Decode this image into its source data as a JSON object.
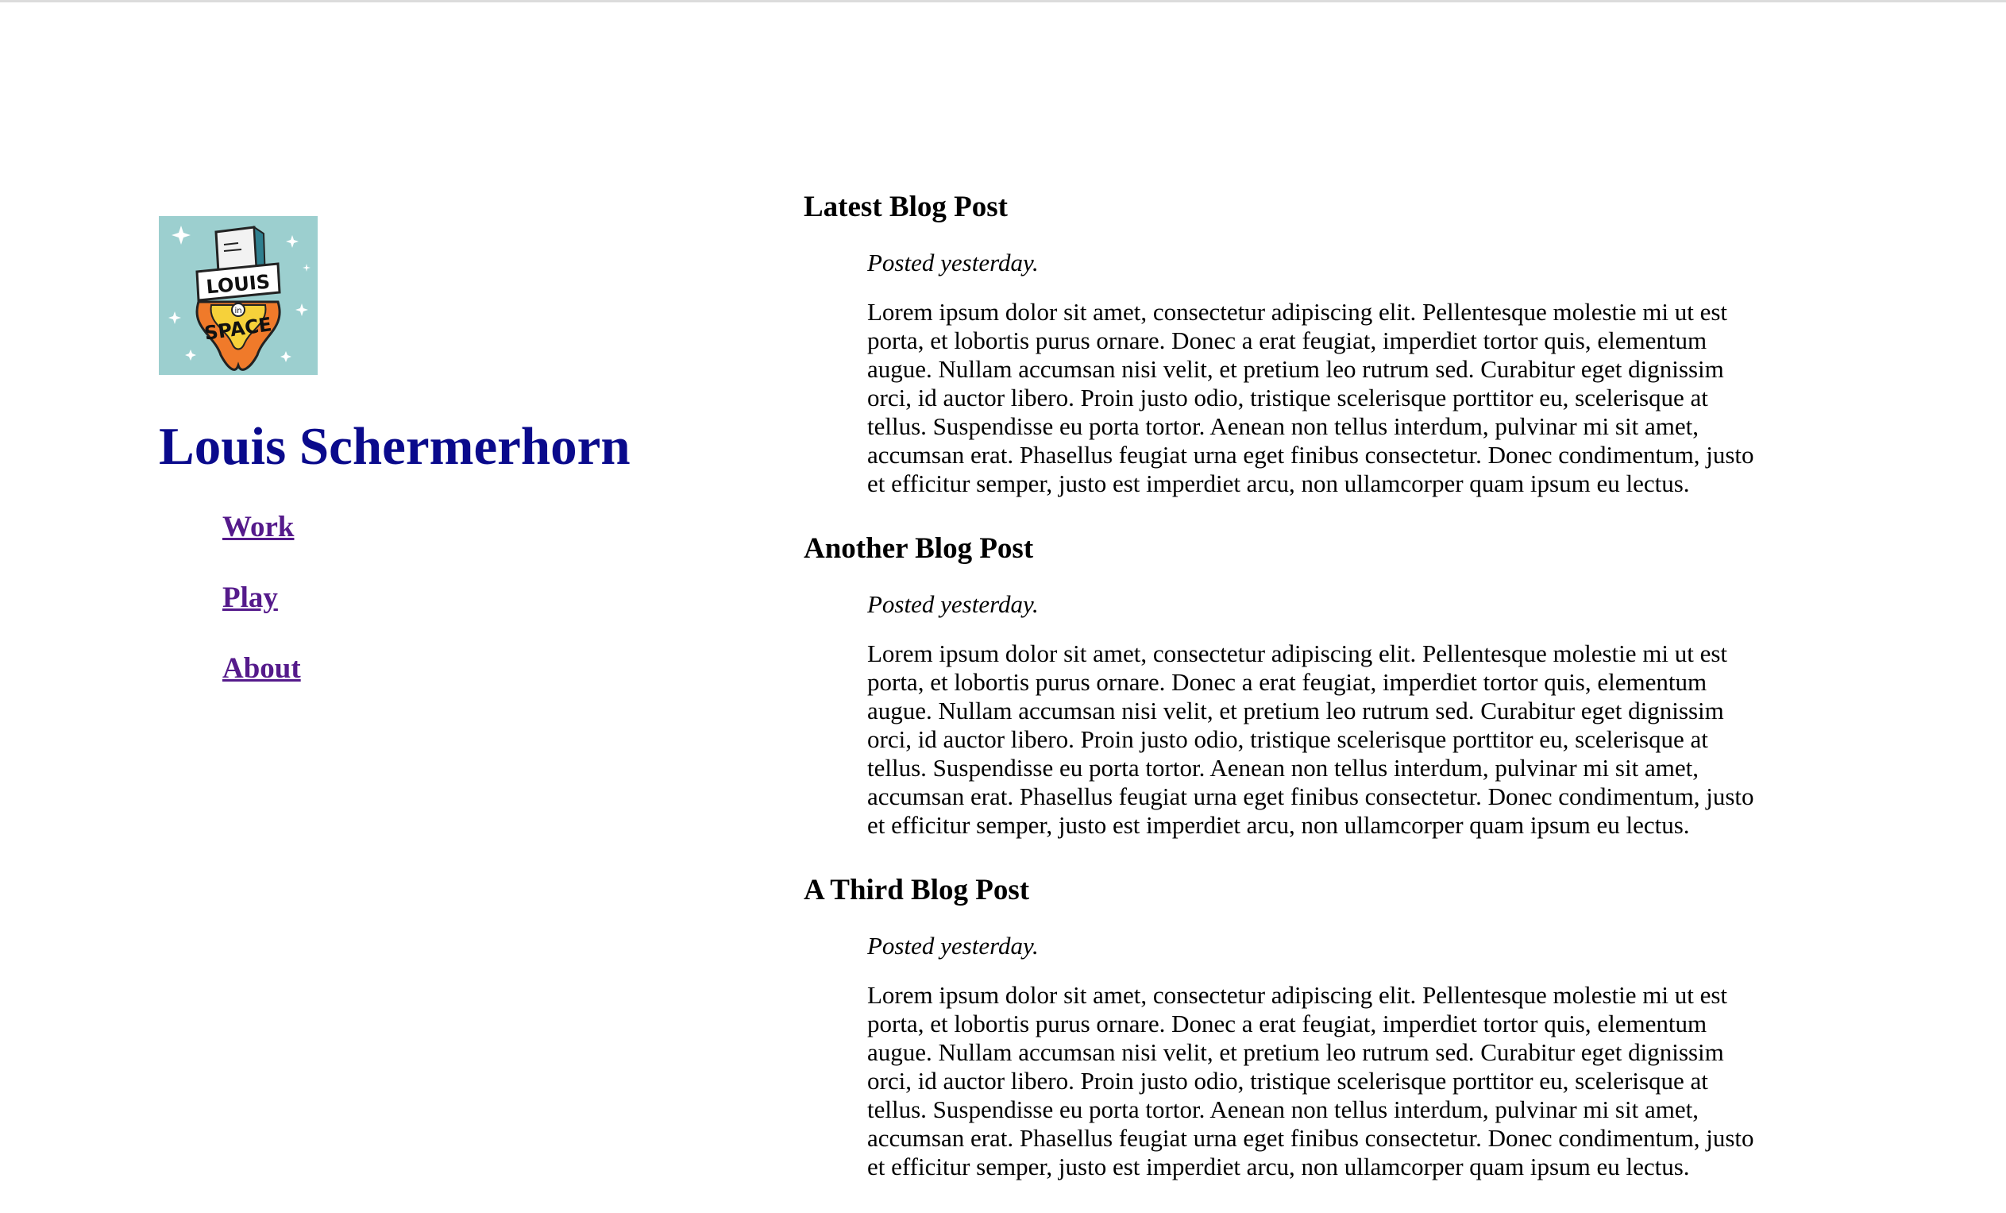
{
  "site": {
    "title": "Louis Schermerhorn",
    "logo_alt": "Louis in Space logo",
    "logo_text_top": "LOUIS",
    "logo_text_mid": "in",
    "logo_text_bottom": "SPACE"
  },
  "nav": {
    "items": [
      {
        "label": "Work"
      },
      {
        "label": "Play"
      },
      {
        "label": "About"
      }
    ]
  },
  "posts": [
    {
      "title": "Latest Blog Post",
      "date": "Posted yesterday.",
      "body": "Lorem ipsum dolor sit amet, consectetur adipiscing elit. Pellentesque molestie mi ut est porta, et lobortis purus ornare. Donec a erat feugiat, imperdiet tortor quis, elementum augue. Nullam accumsan nisi velit, et pretium leo rutrum sed. Curabitur eget dignissim orci, id auctor libero. Proin justo odio, tristique scelerisque porttitor eu, scelerisque at tellus. Suspendisse eu porta tortor. Aenean non tellus interdum, pulvinar mi sit amet, accumsan erat. Phasellus feugiat urna eget finibus consectetur. Donec condimentum, justo et efficitur semper, justo est imperdiet arcu, non ullamcorper quam ipsum eu lectus."
    },
    {
      "title": "Another Blog Post",
      "date": "Posted yesterday.",
      "body": "Lorem ipsum dolor sit amet, consectetur adipiscing elit. Pellentesque molestie mi ut est porta, et lobortis purus ornare. Donec a erat feugiat, imperdiet tortor quis, elementum augue. Nullam accumsan nisi velit, et pretium leo rutrum sed. Curabitur eget dignissim orci, id auctor libero. Proin justo odio, tristique scelerisque porttitor eu, scelerisque at tellus. Suspendisse eu porta tortor. Aenean non tellus interdum, pulvinar mi sit amet, accumsan erat. Phasellus feugiat urna eget finibus consectetur. Donec condimentum, justo et efficitur semper, justo est imperdiet arcu, non ullamcorper quam ipsum eu lectus."
    },
    {
      "title": "A Third Blog Post",
      "date": "Posted yesterday.",
      "body": "Lorem ipsum dolor sit amet, consectetur adipiscing elit. Pellentesque molestie mi ut est porta, et lobortis purus ornare. Donec a erat feugiat, imperdiet tortor quis, elementum augue. Nullam accumsan nisi velit, et pretium leo rutrum sed. Curabitur eget dignissim orci, id auctor libero. Proin justo odio, tristique scelerisque porttitor eu, scelerisque at tellus. Suspendisse eu porta tortor. Aenean non tellus interdum, pulvinar mi sit amet, accumsan erat. Phasellus feugiat urna eget finibus consectetur. Donec condimentum, justo et efficitur semper, justo est imperdiet arcu, non ullamcorper quam ipsum eu lectus."
    }
  ],
  "colors": {
    "title": "#0a0a8c",
    "link_visited": "#551a8b",
    "logo_bg": "#9ccfcf",
    "flame_orange": "#f07a2a",
    "flame_yellow": "#f6d13a"
  }
}
